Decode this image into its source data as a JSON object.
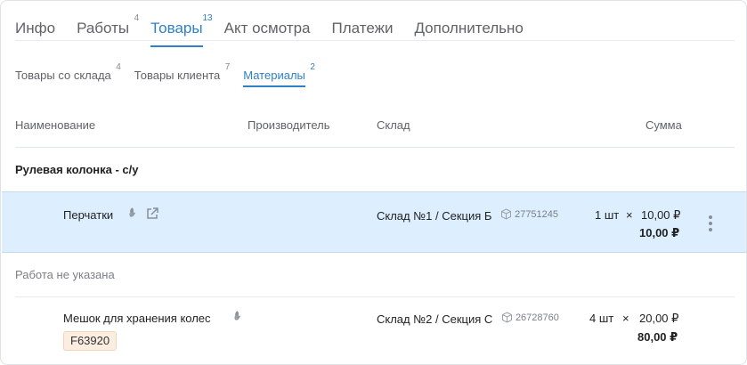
{
  "main_tabs": [
    {
      "label": "Инфо",
      "count": ""
    },
    {
      "label": "Работы",
      "count": "4"
    },
    {
      "label": "Товары",
      "count": "13"
    },
    {
      "label": "Акт осмотра",
      "count": ""
    },
    {
      "label": "Платежи",
      "count": ""
    },
    {
      "label": "Дополнительно",
      "count": ""
    }
  ],
  "sub_tabs": [
    {
      "label": "Товары со склада",
      "count": "4"
    },
    {
      "label": "Товары клиента",
      "count": "7"
    },
    {
      "label": "Материалы",
      "count": "2"
    }
  ],
  "table": {
    "col_name": "Наименование",
    "col_maker": "Производитель",
    "col_warehouse": "Склад",
    "col_sum": "Сумма"
  },
  "groups": [
    {
      "title": "Рулевая колонка - с/у"
    },
    {
      "title": "Работа не указана"
    }
  ],
  "rows": [
    {
      "name": "Перчатки",
      "warehouse": "Склад №1 / Секция Б",
      "code": "27751245",
      "qty": "1 шт",
      "times": "×",
      "price": "10,00 ₽",
      "total": "10,00 ₽",
      "tag": ""
    },
    {
      "name": "Мешок для хранения колес",
      "warehouse": "Склад №2 / Секция С",
      "code": "26728760",
      "qty": "4 шт",
      "times": "×",
      "price": "20,00 ₽",
      "total": "80,00 ₽",
      "tag": "F63920"
    }
  ],
  "colors": {
    "accent": "#2f80c8",
    "selected_row": "#ddeefe",
    "tag_bg": "#fbeee0"
  },
  "icons": [
    "hand-icon",
    "external-link-icon",
    "box-icon",
    "kebab-menu-icon"
  ]
}
